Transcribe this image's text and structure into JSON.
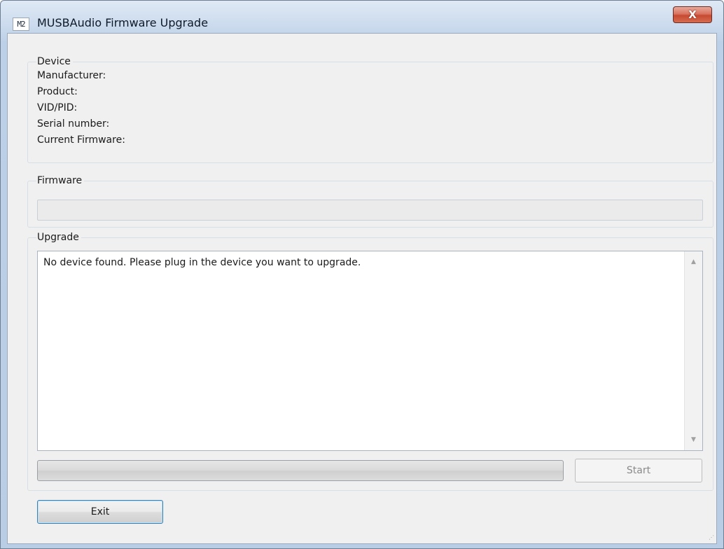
{
  "window": {
    "title": "MUSBAudio Firmware Upgrade",
    "app_icon_text": "M2",
    "close_label": "X"
  },
  "device": {
    "caption": "Device",
    "fields": {
      "manufacturer": "Manufacturer:",
      "product": "Product:",
      "vid_pid": "VID/PID:",
      "serial": "Serial number:",
      "current_firmware": "Current Firmware:"
    }
  },
  "firmware": {
    "caption": "Firmware",
    "value": ""
  },
  "upgrade": {
    "caption": "Upgrade",
    "log_text": "No device found. Please plug in the device you want to upgrade.",
    "progress_fraction": 0,
    "start_label": "Start"
  },
  "footer": {
    "exit_label": "Exit"
  },
  "icons": {
    "scroll_up": "scroll-up-arrow-icon",
    "scroll_down": "scroll-down-arrow-icon",
    "resize_grip": "resize-grip-icon"
  },
  "colors": {
    "window_frame": "#b9cde5",
    "close_button": "#c64a32",
    "dialog_background": "#f0f0f0",
    "exit_button_border": "#3c7fb1"
  }
}
